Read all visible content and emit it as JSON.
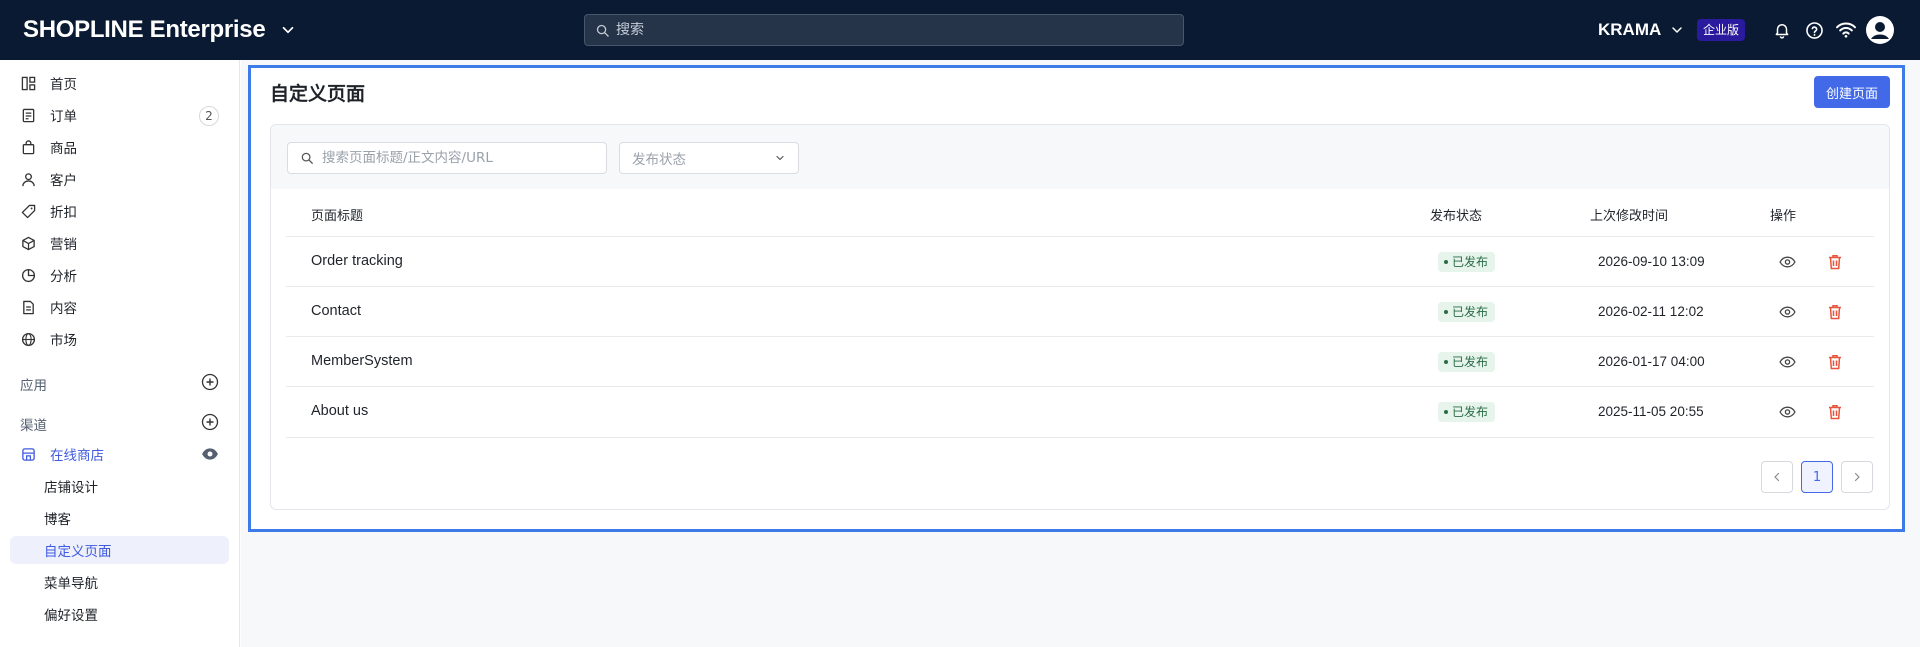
{
  "header": {
    "brand": "SHOPLINE Enterprise",
    "search_placeholder": "搜索",
    "store_name": "KRAMA",
    "plan_badge": "企业版",
    "icons": [
      "chevron-down-icon",
      "search-icon",
      "bell-icon",
      "help-icon",
      "wifi-icon",
      "avatar-icon"
    ]
  },
  "sidebar": {
    "items": [
      {
        "label": "首页",
        "icon": "home-icon"
      },
      {
        "label": "订单",
        "icon": "order-icon",
        "count": "2"
      },
      {
        "label": "商品",
        "icon": "bag-icon"
      },
      {
        "label": "客户",
        "icon": "user-icon"
      },
      {
        "label": "折扣",
        "icon": "tag-icon"
      },
      {
        "label": "营销",
        "icon": "marketing-icon"
      },
      {
        "label": "分析",
        "icon": "chart-icon"
      },
      {
        "label": "内容",
        "icon": "content-icon"
      },
      {
        "label": "市场",
        "icon": "globe-icon"
      }
    ],
    "apps_label": "应用",
    "channels_label": "渠道",
    "channel_store": "在线商店",
    "sub_items": [
      {
        "label": "店铺设计"
      },
      {
        "label": "博客"
      },
      {
        "label": "自定义页面",
        "active": true
      },
      {
        "label": "菜单导航"
      },
      {
        "label": "偏好设置"
      }
    ]
  },
  "main": {
    "title": "自定义页面",
    "create_button": "创建页面",
    "filter": {
      "search_placeholder": "搜索页面标题/正文内容/URL",
      "status_placeholder": "发布状态"
    },
    "table": {
      "headers": {
        "title": "页面标题",
        "status": "发布状态",
        "modified": "上次修改时间",
        "actions": "操作"
      },
      "rows": [
        {
          "title": "Order tracking",
          "status": "已发布",
          "modified": "2026-09-10 13:09"
        },
        {
          "title": "Contact",
          "status": "已发布",
          "modified": "2026-02-11 12:02"
        },
        {
          "title": "MemberSystem",
          "status": "已发布",
          "modified": "2026-01-17 04:00"
        },
        {
          "title": "About us",
          "status": "已发布",
          "modified": "2025-11-05 20:55"
        }
      ]
    },
    "pagination": {
      "current": "1"
    }
  },
  "colors": {
    "topbar": "#0b1a33",
    "accent": "#4169e8",
    "active_bg": "#eef1fb",
    "published_bg": "#e6f4ec",
    "delete": "#e8553d"
  }
}
